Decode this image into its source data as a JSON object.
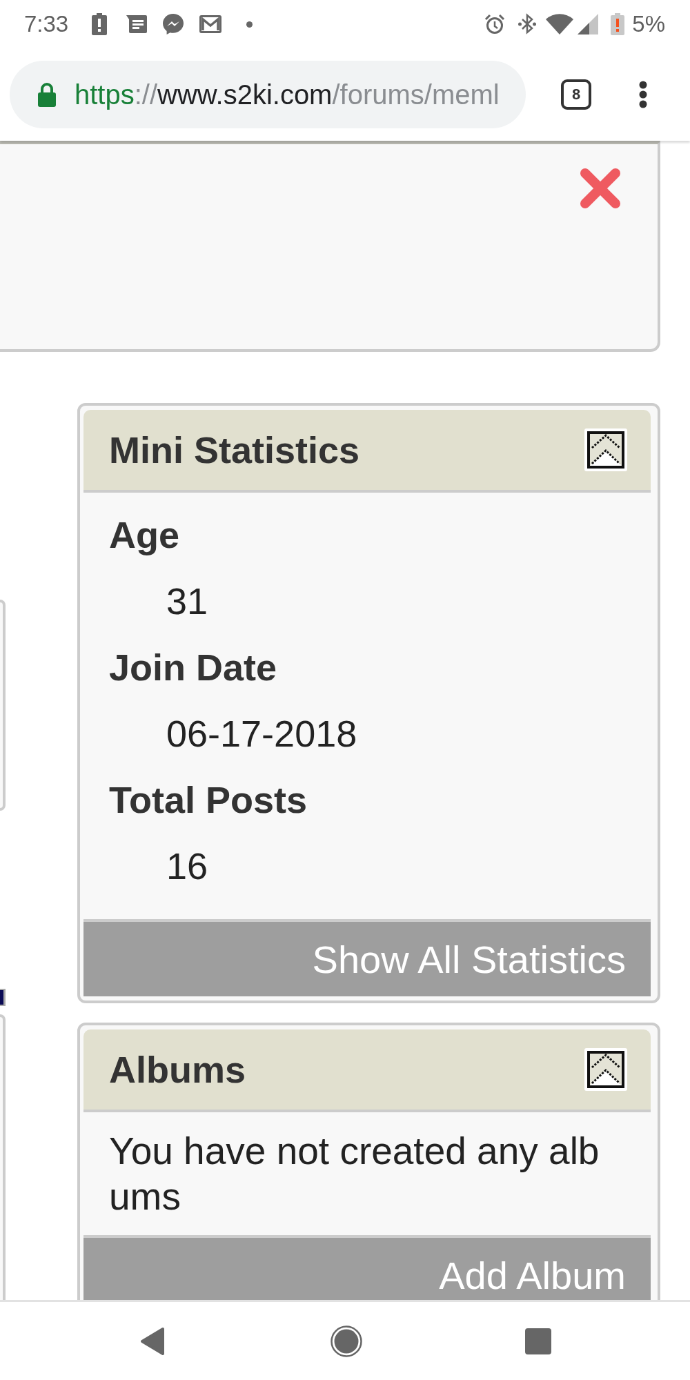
{
  "status_bar": {
    "time": "7:33",
    "battery": "5%"
  },
  "browser": {
    "url": {
      "scheme": "https",
      "separator": "://",
      "host": "www.s2ki.com",
      "path": "/forums/meml"
    },
    "tab_count": "8"
  },
  "cards": [
    {
      "kind": "stats",
      "title": "Mini Statistics",
      "expanded": true,
      "items": [
        {
          "label": "Age",
          "value": "31"
        },
        {
          "label": "Join Date",
          "value": "06-17-2018"
        },
        {
          "label": "Total Posts",
          "value": "16"
        }
      ],
      "footer_link": "Show All Statistics"
    },
    {
      "kind": "message",
      "title": "Albums",
      "expanded": true,
      "message": "You have not created any albums",
      "footer_link": "Add Album"
    }
  ]
}
